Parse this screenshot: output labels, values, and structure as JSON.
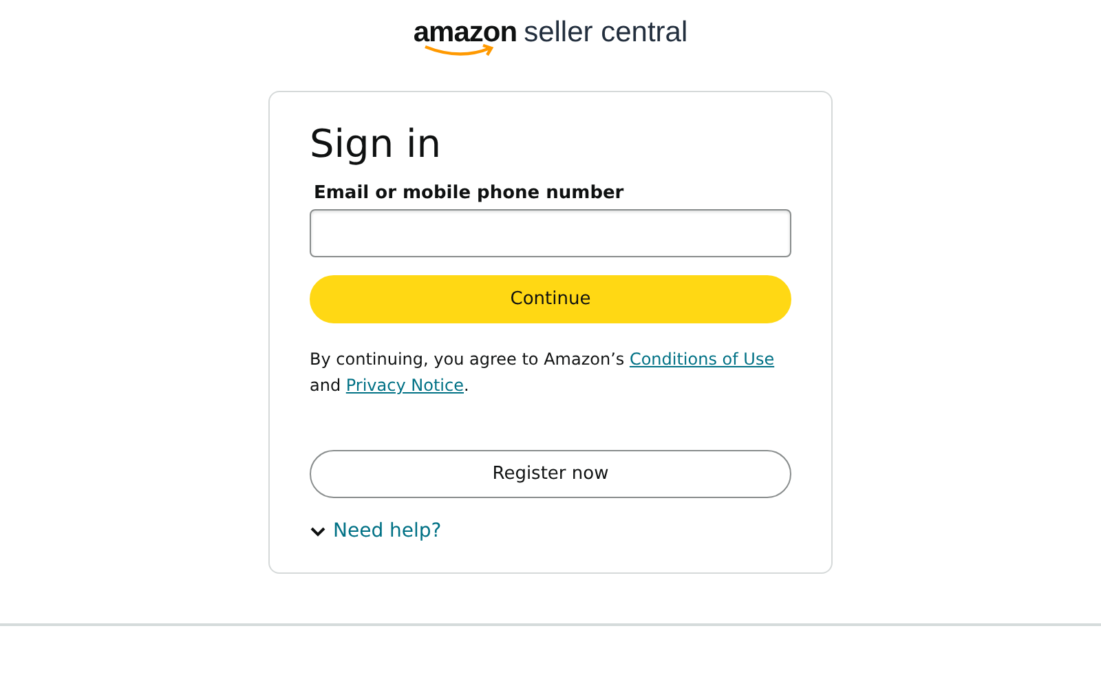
{
  "logo": {
    "brand": "amazon",
    "product": "seller central"
  },
  "signin": {
    "title": "Sign in",
    "email_field": {
      "label": "Email or mobile phone number"
    },
    "continue_button": "Continue",
    "legal": {
      "before": "By continuing, you agree to Amazon’s ",
      "link_1": "Conditions of Use",
      "between": " and ",
      "link_2": "Privacy Notice",
      "after": "."
    },
    "register_button": "Register now",
    "help": {
      "label": "Need help?",
      "expanded": false
    }
  }
}
